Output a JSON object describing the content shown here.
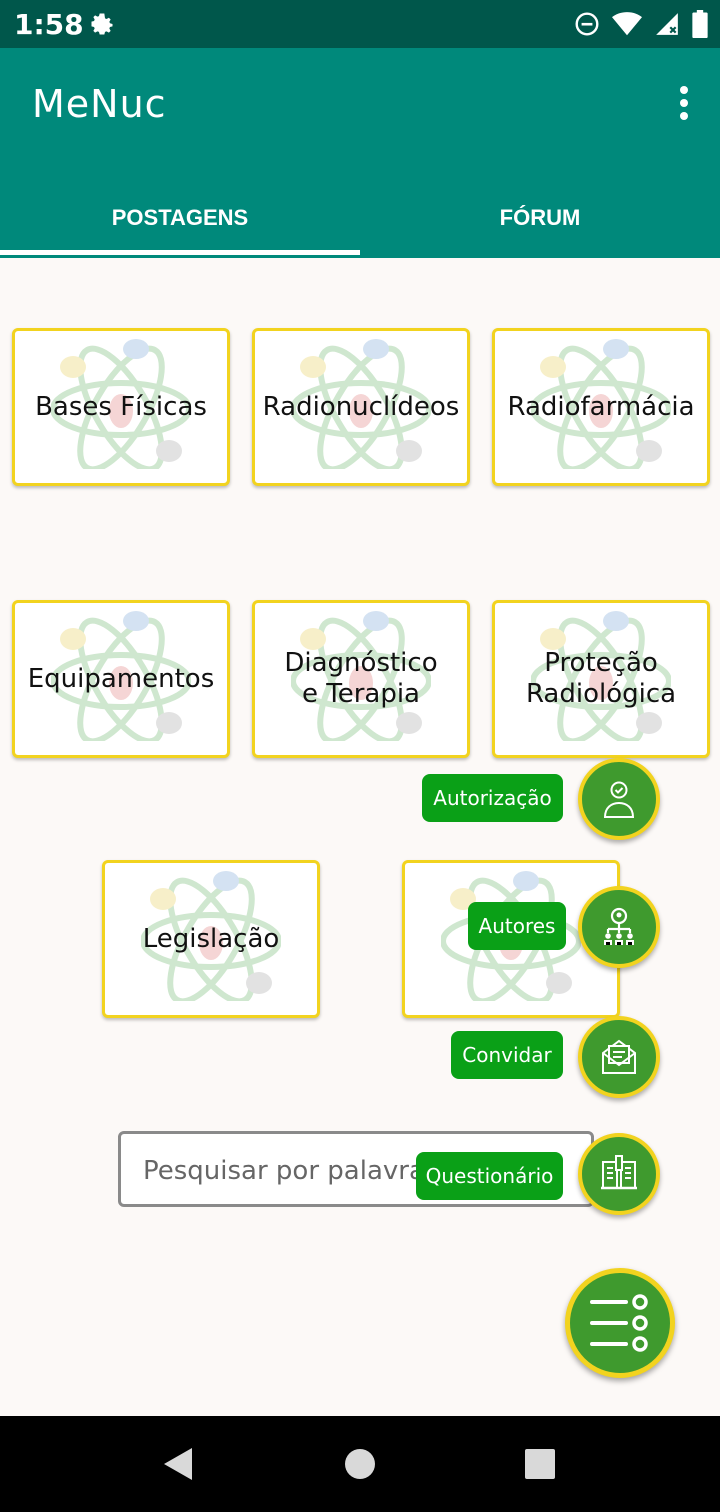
{
  "status_bar": {
    "time": "1:58"
  },
  "app_bar": {
    "title": "MeNuc"
  },
  "tabs": [
    {
      "label": "POSTAGENS",
      "selected": true
    },
    {
      "label": "FÓRUM",
      "selected": false
    }
  ],
  "topics": [
    {
      "label": "Bases Físicas"
    },
    {
      "label": "Radionuclídeos"
    },
    {
      "label": "Radiofarmácia"
    },
    {
      "label": "Equipamentos"
    },
    {
      "label": "Diagnóstico e Terapia"
    },
    {
      "label": "Proteção Radiológica"
    },
    {
      "label": "Legislação"
    },
    {
      "label": ""
    }
  ],
  "search": {
    "placeholder": "Pesquisar por palavra-chave"
  },
  "fab_menu": {
    "items": [
      {
        "label": "Autorização",
        "icon": "user-check-icon"
      },
      {
        "label": "Autores",
        "icon": "team-icon"
      },
      {
        "label": "Convidar",
        "icon": "mail-invite-icon"
      },
      {
        "label": "Questionário",
        "icon": "quiz-book-icon"
      }
    ],
    "main_icon": "menu-list-icon"
  },
  "colors": {
    "status_bar": "#00574b",
    "app_bar": "#00897b",
    "card_border": "#f2d31f",
    "chip": "#0aa017",
    "fab": "#3f9a2e"
  }
}
